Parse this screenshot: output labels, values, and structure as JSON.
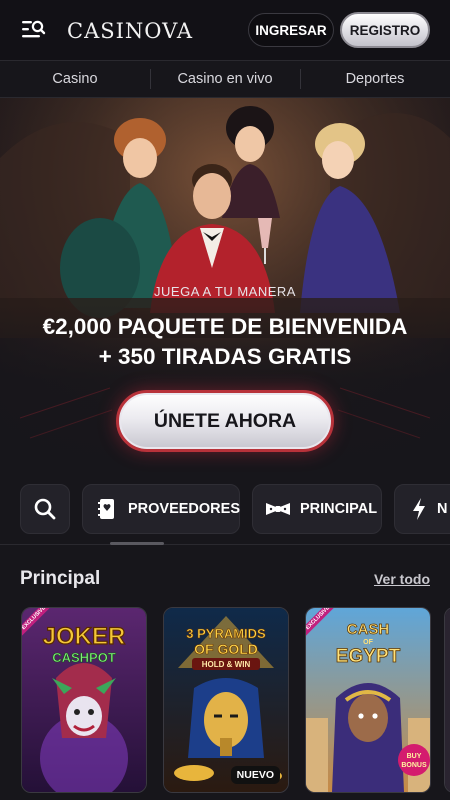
{
  "header": {
    "brand": "CASINOVA",
    "login_label": "INGRESAR",
    "register_label": "REGISTRO"
  },
  "nav": {
    "tabs": [
      {
        "label": "Casino"
      },
      {
        "label": "Casino en vivo"
      },
      {
        "label": "Deportes"
      }
    ]
  },
  "hero": {
    "eyebrow": "JUEGA A TU MANERA",
    "title_line1": "€2,000 PAQUETE DE BIENVENIDA",
    "title_line2": "+ 350 TIRADAS GRATIS",
    "cta_label": "ÚNETE AHORA"
  },
  "chips": [
    {
      "label": "",
      "icon": "search-icon"
    },
    {
      "label": "PROVEEDORES",
      "icon": "book-icon"
    },
    {
      "label": "PRINCIPAL",
      "icon": "bowtie-icon"
    },
    {
      "label": "N",
      "icon": "lightning-icon"
    }
  ],
  "section": {
    "title": "Principal",
    "see_all": "Ver todo"
  },
  "games": [
    {
      "title_line1": "JOKER",
      "title_line2": "CASHPOT",
      "ribbon": "EXCLUSIVE",
      "badge": ""
    },
    {
      "title_line1": "3 PYRAMIDS",
      "title_line2": "OF GOLD",
      "subtitle": "HOLD & WIN",
      "badge": "NUEVO",
      "ribbon": ""
    },
    {
      "title_line1": "CASH",
      "title_line2": "EGYPT",
      "title_of": "OF",
      "ribbon": "EXCLUSIVE",
      "badge": "",
      "sticker_line1": "BUY",
      "sticker_line2": "BONUS"
    }
  ],
  "colors": {
    "background": "#17161b",
    "header": "#121116",
    "cta_border": "#b8323a"
  }
}
